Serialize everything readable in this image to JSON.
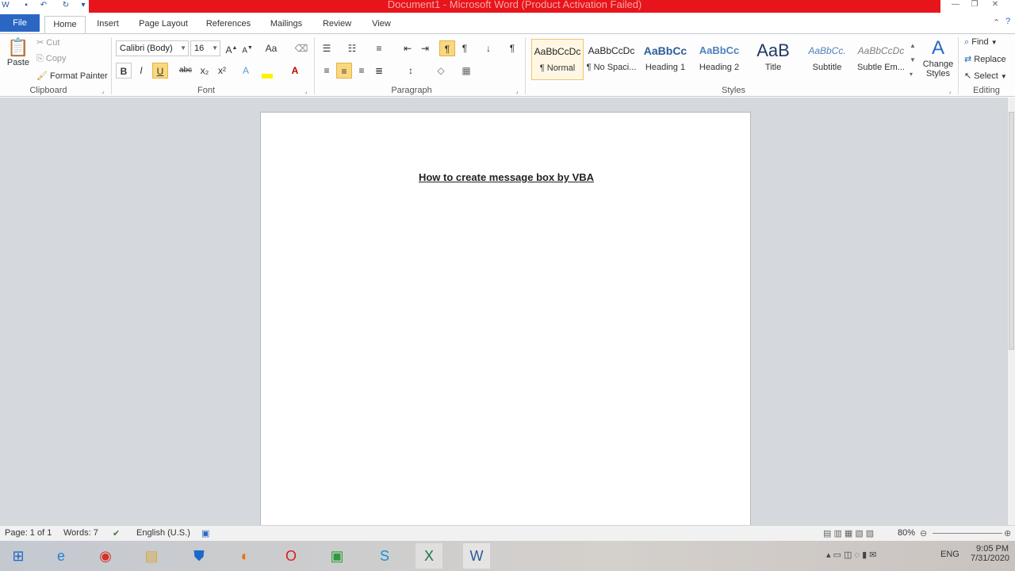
{
  "window": {
    "title": "Document1 - Microsoft Word (Product Activation Failed)",
    "controls": [
      "—",
      "❐",
      "✕"
    ]
  },
  "tabs": [
    "File",
    "Home",
    "Insert",
    "Page Layout",
    "References",
    "Mailings",
    "Review",
    "View"
  ],
  "clipboard": {
    "paste": "Paste",
    "cut": "Cut",
    "copy": "Copy",
    "format_painter": "Format Painter",
    "group_label": "Clipboard"
  },
  "font": {
    "font_name": "Calibri (Body)",
    "font_size": "16",
    "bold": "B",
    "italic": "I",
    "underline": "U",
    "strike": "abc",
    "subscript": "x₂",
    "superscript": "x²",
    "group_label": "Font"
  },
  "paragraph": {
    "group_label": "Paragraph"
  },
  "styles": {
    "items": [
      {
        "sample": "AaBbCcDc",
        "name": "¶ Normal"
      },
      {
        "sample": "AaBbCcDc",
        "name": "¶ No Spaci..."
      },
      {
        "sample": "AaBbCc",
        "name": "Heading 1"
      },
      {
        "sample": "AaBbCc",
        "name": "Heading 2"
      },
      {
        "sample": "AaB",
        "name": "Title"
      },
      {
        "sample": "AaBbCc.",
        "name": "Subtitle"
      },
      {
        "sample": "AaBbCcDc",
        "name": "Subtle Em..."
      }
    ],
    "change_styles": "Change Styles",
    "group_label": "Styles"
  },
  "editing": {
    "find": "Find",
    "replace": "Replace",
    "select": "Select",
    "group_label": "Editing"
  },
  "document": {
    "title": "How to create message box by VBA"
  },
  "status": {
    "page": "Page: 1 of 1",
    "words": "Words: 7",
    "language": "English (U.S.)",
    "zoom": "80%"
  },
  "taskbar": {
    "language": "ENG",
    "time": "9:05 PM",
    "date": "7/31/2020"
  }
}
